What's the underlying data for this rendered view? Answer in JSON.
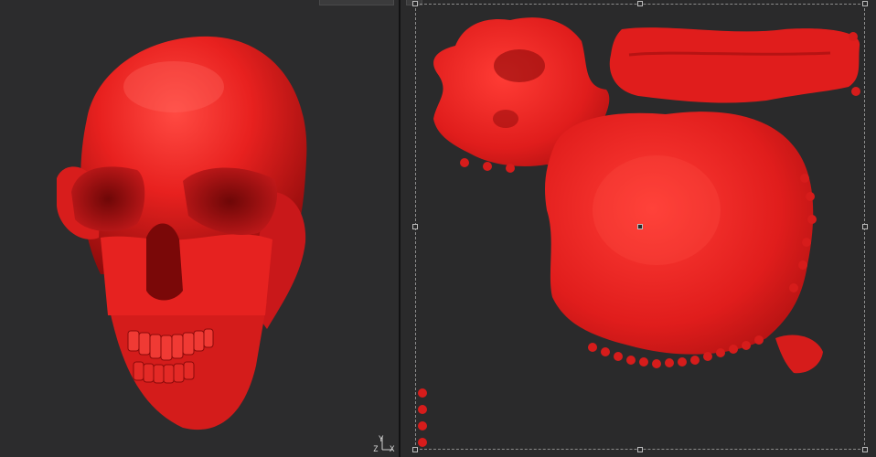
{
  "viewports": {
    "perspective": {
      "name": "3d-viewport"
    },
    "uv_editor": {
      "name": "uv-editor-viewport"
    }
  },
  "gizmo": {
    "axis_z": "Z",
    "axis_x": "X",
    "axis_y": "Y"
  },
  "colors": {
    "background": "#2c2c2d",
    "mesh_red": "#e8211f",
    "mesh_dark": "#9e0d0d",
    "frame": "#8c8c8c"
  }
}
